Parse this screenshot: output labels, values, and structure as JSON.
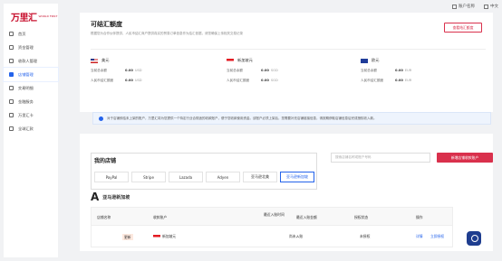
{
  "logo": {
    "cn": "万里汇",
    "en": "WORLD FIRST"
  },
  "topbar": {
    "account": "账户名称",
    "lang": "中文"
  },
  "sidebar": {
    "items": [
      {
        "label": "首页"
      },
      {
        "label": "资金管理"
      },
      {
        "label": "收款人管理"
      },
      {
        "label": "店铺管理"
      },
      {
        "label": "交易明细"
      },
      {
        "label": "金融服务"
      },
      {
        "label": "万里汇卡"
      },
      {
        "label": "全球汇款"
      }
    ]
  },
  "top_card": {
    "title": "可结汇额度",
    "desc": "根据您为合作伙伴提供、人民币结汇商户提供真实的贸易订单信息作为结汇依据，请您确保上传相关交易记录",
    "apply": "查看结汇额度",
    "currencies": [
      {
        "name": "美元",
        "r1k": "当前总余额",
        "r1v": "0.00",
        "r1u": "USD",
        "r2k": "人民币结汇额度",
        "r2v": "0.00",
        "r2u": "USD"
      },
      {
        "name": "新加坡元",
        "r1k": "当前总余额",
        "r1v": "0.00",
        "r1u": "SGD",
        "r2k": "人民币结汇额度",
        "r2v": "0.00",
        "r2u": "SGD"
      },
      {
        "name": "欧元",
        "r1k": "当前总余额",
        "r1v": "0.00",
        "r1u": "EUR",
        "r2k": "人民币结汇额度",
        "r2v": "0.00",
        "r2u": "EUR"
      }
    ]
  },
  "notice": "对于店铺即结未上架的账户，万里汇将为您提供一个特定行业合规适的收款账户，便于您收款使用资金。该账户必须上架后，您需要补充店铺链接信息，请按期获取店铺信息后完成授权收入款。",
  "stores": {
    "title": "我的店铺",
    "tabs": [
      "PayPal",
      "Stripe",
      "Lazada",
      "Adyen",
      "亚马逊北美",
      "亚马逊新加坡"
    ],
    "search_placeholder": "搜索店铺名称或账户号码",
    "add": "新增店铺收款账户",
    "section": "亚马逊新加坡",
    "columns": [
      "店铺名称",
      "收款账户",
      "最近入账时间",
      "最近入账金额",
      "授权状态",
      "操作"
    ],
    "rows": [
      {
        "badge": "更新",
        "account": "新加坡元",
        "time": "尚未入账",
        "amount": "--",
        "status": "未授权",
        "op1": "详情",
        "op2": "立即授权"
      }
    ]
  }
}
